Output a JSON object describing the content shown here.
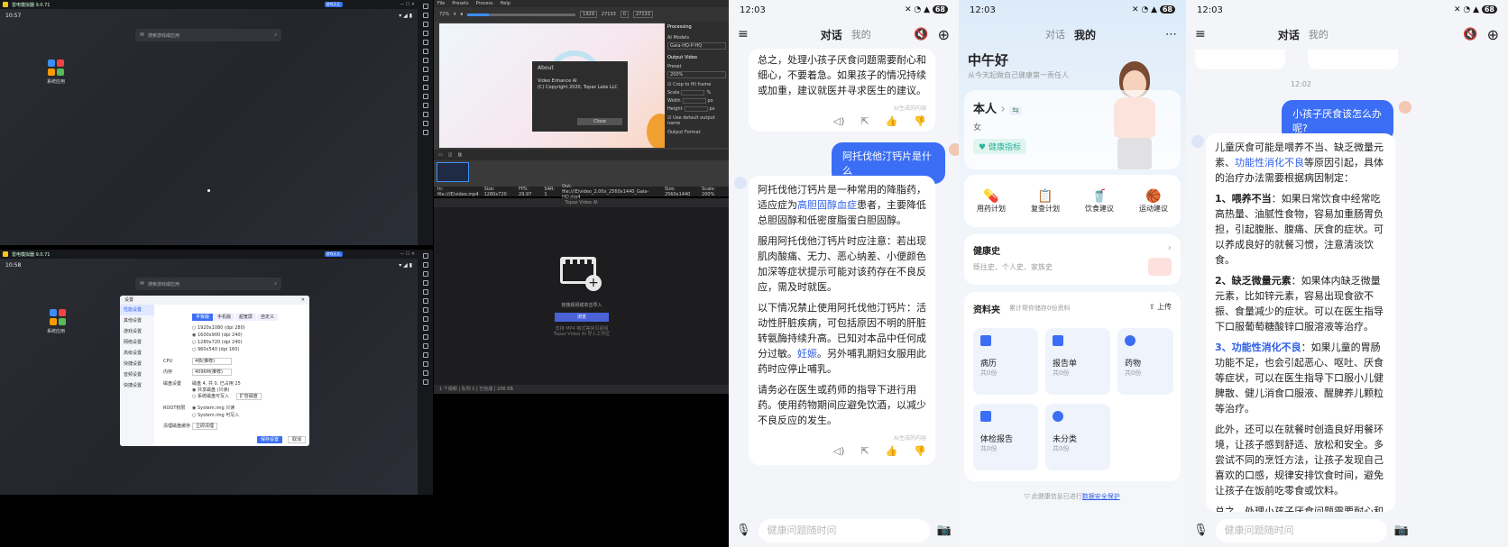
{
  "emulator1": {
    "title": "雷电模拟器 9.0.71",
    "badge": "游戏无比",
    "time": "10:57",
    "search_placeholder": "搜索游戏或应用",
    "app_label": "系统应用"
  },
  "emulator2": {
    "title": "雷电模拟器 9.0.71",
    "badge": "游戏无比",
    "time": "10:58",
    "search_placeholder": "搜索游戏或应用",
    "app_label": "系统应用",
    "dialog": {
      "title": "设置",
      "nav": [
        "性能设置",
        "其他设置",
        "游戏设置",
        "网络设置",
        "高级设置",
        "快捷设置",
        "音频设置",
        "快捷设置"
      ],
      "tabs": [
        "平板版",
        "手机版",
        "超宽屏",
        "自定义"
      ],
      "resolutions": [
        "1920x1080 (dpi 280)",
        "1600x900 (dpi 240)",
        "1280x720 (dpi 240)",
        "960x540 (dpi 160)"
      ],
      "cpu_label": "CPU",
      "cpu_value": "4核(推荐)",
      "mem_label": "内存",
      "mem_value": "4096M(推荐)",
      "disk_label": "磁盘设置",
      "disk_value": "磁盘 4, 共 0, 已占用 25",
      "disk_opt1": "共享磁盘 (只读)",
      "disk_opt2": "系统磁盘可写入",
      "disk_btn": "扩容磁盘",
      "root_label": "ROOT权限",
      "root_opt1": "System.img 只读",
      "root_opt2": "System.img 可写入",
      "shortcut_label": "清理磁盘缓存",
      "shortcut_btn": "立即清理",
      "save": "保存设置",
      "cancel": "取消"
    }
  },
  "video1": {
    "menu": [
      "File",
      "Presets",
      "Process",
      "Help"
    ],
    "zoom": "72%",
    "time_start": "1929",
    "time_mid": "27133",
    "time_a": "0",
    "time_b": "27133",
    "about": {
      "title": "About",
      "line1": "Video Enhance AI",
      "line2": "(C) Copyright 2020, Topaz Labs LLC",
      "close": "Close"
    },
    "panel": {
      "processing": "Processing",
      "ai_models": "AI Models",
      "model": "Gaia-HQ-P-HQ",
      "output_video": "Output Video",
      "preset": "Preset",
      "preset_value": "200%",
      "crop": "Crop to fill frame",
      "scale": "Scale",
      "scale_unit": "%",
      "width": "Width",
      "height": "Height",
      "px": "px",
      "default_out": "Use default output name",
      "output_format": "Output Format"
    },
    "footer_in": "In: file:///E/video.mp4",
    "footer_size": "Size: 1280x720",
    "footer_fps": "FPS: 29.97",
    "footer_sar": "SAR: 1",
    "footer_out": "Out: file:///E/video_2.00x_2560x1440_Gaia-HQ.mp4",
    "footer_osize": "Size: 2560x1440",
    "footer_oscale": "Scale: 200%"
  },
  "video2": {
    "title": "Topaz Video AI",
    "drop_line": "拖拽视频或单击导入",
    "browse": "浏览",
    "hint1": "支持 MP4 格式等常见视频",
    "hint2": "Topaz Video AI 导入工作区",
    "status": "1 个视频  |  队列 1 | 已完成 | 206 KB"
  },
  "chat1": {
    "time": "12:03",
    "battery": "68",
    "tab_chat": "对话",
    "tab_mine": "我的",
    "prev_text": "总之，处理小孩子厌食问题需要耐心和细心，不要着急。如果孩子的情况持续或加重，建议就医并寻求医生的建议。",
    "ai_tag": "AI生成的内容",
    "question": "阿托伐他汀钙片是什么",
    "answer_p1_a": "阿托伐他汀钙片是一种常用的降脂药，适应症为",
    "answer_p1_link": "高胆固醇血症",
    "answer_p1_b": "患者，主要降低总胆固醇和低密度脂蛋白胆固醇。",
    "answer_p2": "服用阿托伐他汀钙片时应注意：若出现肌肉酸痛、无力、恶心纳差、小便颜色加深等症状提示可能对该药存在不良反应，需及时就医。",
    "answer_p3_a": "以下情况禁止使用阿托伐他汀钙片：活动性肝脏疾病，可包括原因不明的肝脏转氨酶持续升高。已知对本品中任何成分过敏。",
    "answer_p3_link": "妊娠",
    "answer_p3_b": "。另外哺乳期妇女服用此药时应停止哺乳。",
    "answer_p4": "请务必在医生或药师的指导下进行用药。使用药物期间应避免饮酒，以减少不良反应的发生。",
    "input_placeholder": "健康问题随时问"
  },
  "profile": {
    "time": "12:03",
    "battery": "68",
    "tab_chat": "对话",
    "tab_mine": "我的",
    "greeting": "中午好",
    "subtitle": "从今天起做自己健康第一责任人",
    "user": "本人",
    "gender": "女",
    "health_badge": "健康指标",
    "actions": [
      "用药计划",
      "复查计划",
      "饮食建议",
      "运动建议"
    ],
    "history_title": "健康史",
    "history_sub": "既往史、个人史、家族史",
    "folder_title": "资料夹",
    "folder_sub": "累计帮你储存0份资料",
    "upload": "上传",
    "tiles": [
      {
        "name": "病历",
        "count": "共0份"
      },
      {
        "name": "报告单",
        "count": "共0份"
      },
      {
        "name": "药物",
        "count": "共0份"
      },
      {
        "name": "体检报告",
        "count": "共0份"
      },
      {
        "name": "未分类",
        "count": "共0份"
      }
    ],
    "footer": "此健康信息已进行",
    "footer_link": "数据安全保护"
  },
  "chat2": {
    "time": "12:03",
    "battery": "68",
    "tab_chat": "对话",
    "tab_mine": "我的",
    "msg_time": "12:02",
    "question": "小孩子厌食该怎么办呢?",
    "p1_a": "儿童厌食可能是喂养不当、缺乏微量元素、",
    "p1_link": "功能性消化不良",
    "p1_b": "等原因引起，具体的治疗办法需要根据病因制定：",
    "item1_title": "1、喂养不当",
    "item1_body": "：如果日常饮食中经常吃高热量、油腻性食物，容易加重肠胃负担，引起腹胀、腹痛、厌食的症状。可以养成良好的就餐习惯，注意清淡饮食。",
    "item2_title": "2、缺乏微量元素",
    "item2_body": "：如果体内缺乏微量元素，比如锌元素，容易出现食欲不振、食量减少的症状。可以在医生指导下口服葡萄糖酸锌口服溶液等治疗。",
    "item3_title": "3、功能性消化不良",
    "item3_body": "：如果儿童的胃肠功能不足，也会引起恶心、呕吐、厌食等症状，可以在医生指导下口服小儿健脾散、健儿消食口服液、醒脾养儿颗粒等治疗。",
    "p_extra": "此外，还可以在就餐时创造良好用餐环境，让孩子感到舒适、放松和安全。多尝试不同的烹饪方法，让孩子发现自己喜欢的口感，规律安排饮食时间，避免让孩子在饭前吃零食或饮料。",
    "p_end": "总之，处理小孩子厌食问题需要耐心和细心，不要着急。如果孩子的情况持续或加重，建议就医并寻求医生的建议。",
    "input_placeholder": "健康问题随时问"
  },
  "colors": {
    "accent": "#3b6ef5",
    "teal": "#2bb39a"
  }
}
